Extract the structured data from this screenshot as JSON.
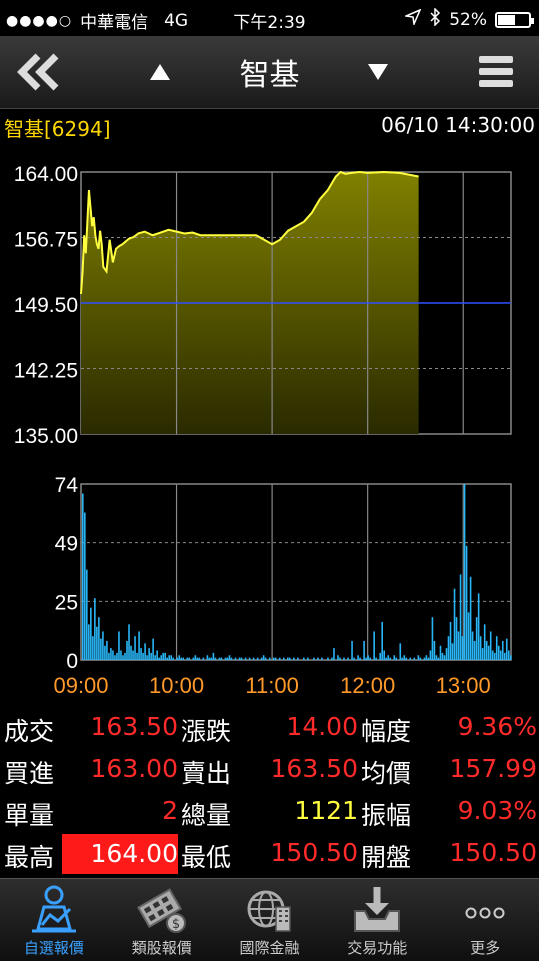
{
  "status": {
    "dots": "●●●●○",
    "carrier": "中華電信",
    "network": "4G",
    "time": "下午2:39",
    "battery": "52%"
  },
  "nav": {
    "title": "智基",
    "back_icon": "double-chevron-left-icon",
    "up_icon": "triangle-up-icon",
    "down_icon": "triangle-down-icon",
    "menu_icon": "hamburger-menu-icon"
  },
  "info": {
    "name": "智基[6294]",
    "datetime": "06/10 14:30:00"
  },
  "chart_data": [
    {
      "type": "area",
      "ylabels": [
        "164.00",
        "156.75",
        "149.50",
        "142.25",
        "135.00"
      ],
      "ylim": [
        135.0,
        164.0
      ],
      "reference": 149.5,
      "x_minutes": [
        0,
        1,
        2,
        3,
        4,
        5,
        6,
        7,
        8,
        9,
        10,
        11,
        12,
        13,
        14,
        16,
        18,
        20,
        22,
        24,
        26,
        28,
        30,
        33,
        36,
        40,
        45,
        50,
        55,
        60,
        65,
        70,
        75,
        80,
        90,
        100,
        110,
        120,
        125,
        130,
        135,
        140,
        145,
        150,
        155,
        160,
        163,
        166,
        170,
        175,
        180,
        190,
        200,
        212
      ],
      "prices": [
        150.5,
        153.0,
        157.0,
        155.0,
        158.5,
        162.0,
        160.0,
        158.0,
        159.0,
        157.0,
        156.0,
        155.5,
        157.5,
        156.0,
        153.5,
        153.0,
        156.5,
        154.0,
        155.5,
        155.8,
        156.0,
        156.3,
        156.6,
        156.8,
        157.2,
        157.4,
        157.0,
        157.3,
        157.6,
        157.4,
        157.2,
        157.3,
        157.0,
        157.0,
        157.0,
        157.0,
        157.0,
        156.0,
        156.5,
        157.5,
        158.0,
        158.5,
        159.5,
        161.0,
        162.0,
        163.5,
        164.0,
        163.8,
        163.9,
        164.0,
        163.9,
        164.0,
        163.9,
        163.5
      ],
      "color": "#ffff40",
      "fill_top": "#808000",
      "fill_bottom": "#2a2a00"
    },
    {
      "type": "bar",
      "ylabels": [
        "74",
        "49",
        "25",
        "0"
      ],
      "ylim": [
        0,
        74
      ],
      "xlabels": [
        "09:00",
        "10:00",
        "11:00",
        "12:00",
        "13:00"
      ],
      "volumes": [
        70,
        62,
        38,
        15,
        22,
        10,
        26,
        14,
        18,
        9,
        12,
        6,
        8,
        3,
        5,
        4,
        2,
        3,
        12,
        4,
        2,
        3,
        8,
        15,
        6,
        4,
        10,
        3,
        12,
        5,
        3,
        7,
        2,
        5,
        3,
        9,
        2,
        4,
        1,
        2,
        3,
        3,
        1,
        2,
        2,
        1,
        0,
        1,
        2,
        1,
        1,
        0,
        1,
        1,
        0,
        1,
        2,
        1,
        1,
        0,
        1,
        0,
        2,
        1,
        1,
        3,
        1,
        0,
        1,
        1,
        0,
        1,
        1,
        2,
        1,
        0,
        1,
        0,
        1,
        1,
        0,
        1,
        0,
        1,
        0,
        1,
        0,
        1,
        0,
        1,
        2,
        1,
        0,
        1,
        0,
        1,
        1,
        0,
        1,
        0,
        1,
        0,
        1,
        1,
        0,
        1,
        0,
        1,
        0,
        0,
        1,
        0,
        1,
        0,
        0,
        1,
        0,
        1,
        0,
        1,
        0,
        0,
        1,
        0,
        1,
        5,
        0,
        2,
        1,
        0,
        1,
        0,
        1,
        0,
        8,
        1,
        0,
        2,
        1,
        0,
        8,
        1,
        2,
        1,
        0,
        12,
        1,
        0,
        3,
        16,
        4,
        1,
        2,
        1,
        0,
        2,
        1,
        0,
        7,
        1,
        2,
        1,
        0,
        1,
        0,
        1,
        0,
        2,
        1,
        0,
        1,
        2,
        1,
        4,
        18,
        8,
        2,
        1,
        6,
        3,
        2,
        5,
        10,
        16,
        7,
        30,
        18,
        12,
        36,
        10,
        74,
        48,
        20,
        35,
        12,
        8,
        18,
        28,
        10,
        5,
        15,
        8,
        6,
        12,
        4,
        3,
        10,
        6,
        4,
        8,
        3,
        9,
        4,
        2
      ],
      "color": "#29b6f6"
    }
  ],
  "quotes": [
    [
      {
        "label": "成交",
        "value": "163.50"
      },
      {
        "label": "漲跌",
        "value": "14.00"
      },
      {
        "label": "幅度",
        "value": "9.36%"
      }
    ],
    [
      {
        "label": "買進",
        "value": "163.00"
      },
      {
        "label": "賣出",
        "value": "163.50"
      },
      {
        "label": "均價",
        "value": "157.99"
      }
    ],
    [
      {
        "label": "單量",
        "value": "2"
      },
      {
        "label": "總量",
        "value": "1121",
        "color": "yellow"
      },
      {
        "label": "振幅",
        "value": "9.03%"
      }
    ],
    [
      {
        "label": "最高",
        "value": "164.00",
        "highlight": true
      },
      {
        "label": "最低",
        "value": "150.50"
      },
      {
        "label": "開盤",
        "value": "150.50"
      }
    ]
  ],
  "tabs": [
    {
      "label": "自選報價",
      "icon": "person-chart-icon",
      "active": true
    },
    {
      "label": "類股報價",
      "icon": "film-coin-icon",
      "active": false
    },
    {
      "label": "國際金融",
      "icon": "globe-building-icon",
      "active": false
    },
    {
      "label": "交易功能",
      "icon": "tray-download-icon",
      "active": false
    },
    {
      "label": "更多",
      "icon": "more-dots-icon",
      "active": false
    }
  ],
  "colors": {
    "up": "#ff2a2a",
    "neutral": "#ffff40",
    "active_tab": "#3aa0ff",
    "ref_line": "#3050ff"
  }
}
